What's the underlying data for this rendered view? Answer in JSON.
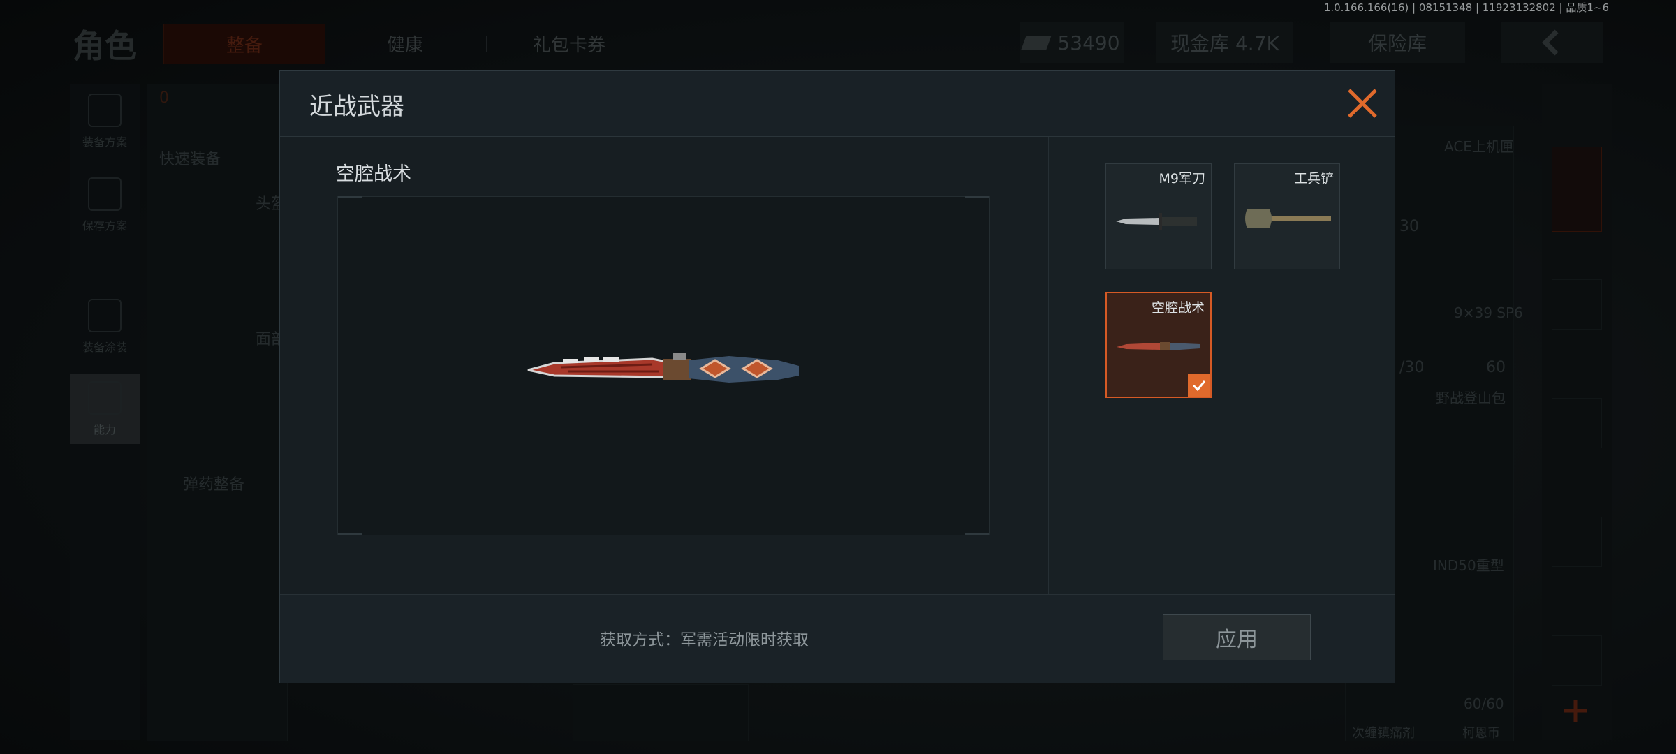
{
  "version": "1.0.166.166(16) | 08151348 | 11923132802 | 品质1~6",
  "topbar": {
    "title": "角色",
    "tabs": [
      "整备",
      "健康",
      "礼包卡券"
    ],
    "currency_value": "53490",
    "cash_vault": "现金库 4.7K",
    "insurance": "保险库"
  },
  "background": {
    "rail": [
      "装备方案",
      "保存方案",
      "装备涂装",
      "能力"
    ],
    "quick_equip": "快速装备",
    "ammo_equip": "弹药整备",
    "slot_head": "头盔",
    "slot_face": "面部",
    "armor_count": "0",
    "ace": "ACE上机匣",
    "ammo_type": "9×39 SP6",
    "ammo_count_a": "30",
    "ammo_count_b": "60",
    "ammo_ratio": "/30",
    "backpack": "野战登山包",
    "helmet": "IND50重型",
    "capacity": "60/60",
    "bottom_left": "次缠镇痛剂",
    "bottom_right": "柯恩币"
  },
  "modal": {
    "title": "近战武器",
    "selected_name": "空腔战术",
    "acquisition": "获取方式：军需活动限时获取",
    "apply_label": "应用",
    "weapons": [
      {
        "name": "M9军刀",
        "selected": false
      },
      {
        "name": "工兵铲",
        "selected": false
      },
      {
        "name": "空腔战术",
        "selected": true
      }
    ]
  },
  "colors": {
    "accent": "#e06a2c",
    "modal_bg": "#161d21",
    "selected_card_bg": "#3a2219"
  }
}
